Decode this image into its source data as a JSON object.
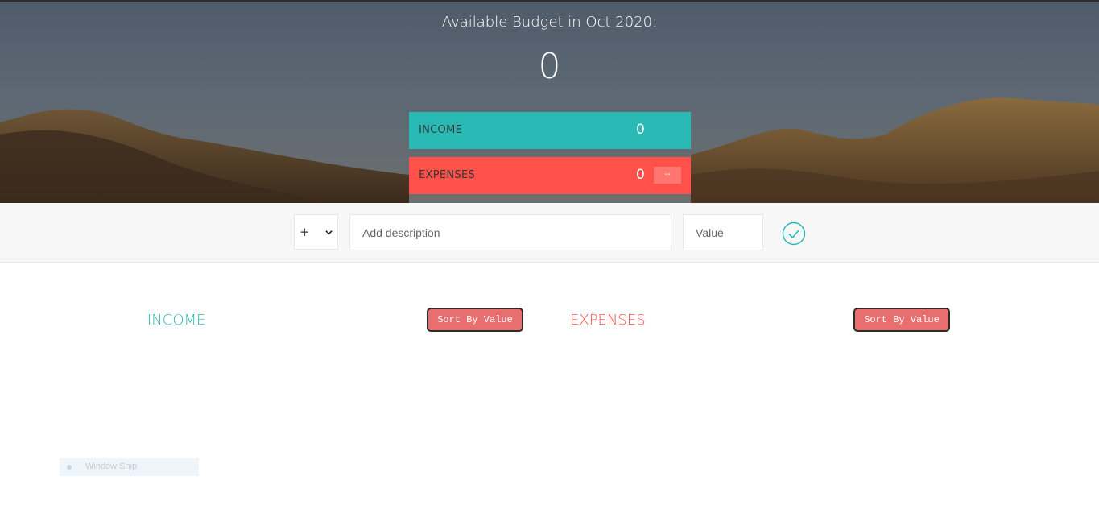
{
  "header": {
    "budget_title": "Available Budget in Oct 2020:",
    "budget_value": "0",
    "income_label": "INCOME",
    "income_value": "0",
    "expenses_label": "EXPENSES",
    "expenses_value": "0",
    "expenses_percentage": "--"
  },
  "add_form": {
    "type_selected": "+",
    "description_placeholder": "Add description",
    "value_placeholder": "Value"
  },
  "lists": {
    "income_title": "INCOME",
    "expenses_title": "EXPENSES",
    "sort_label": "Sort By Value"
  },
  "overlay": {
    "snip_label": "Window Snip"
  },
  "colors": {
    "income": "#28b9b5",
    "expenses": "#ff5049",
    "sort_button": "#e76f6f"
  }
}
